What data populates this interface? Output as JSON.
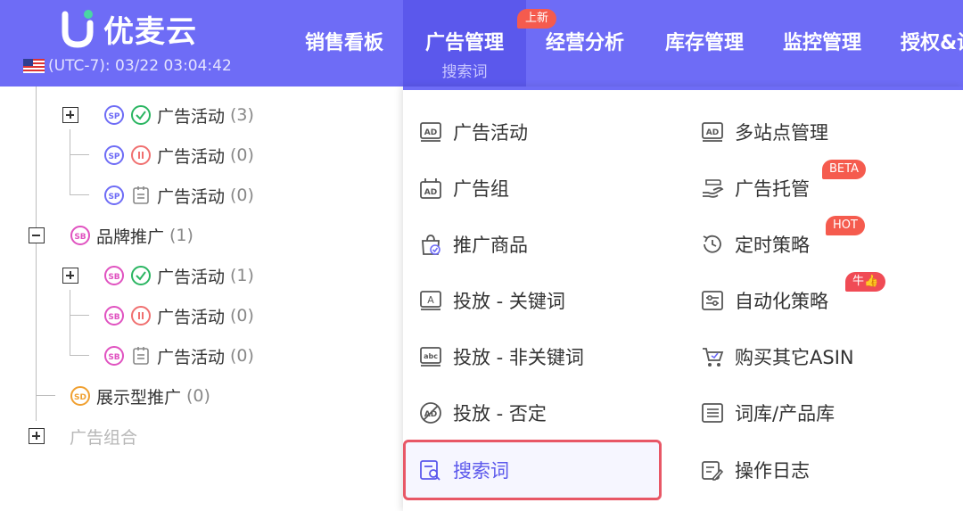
{
  "header": {
    "logo_text": "优麦云",
    "clock": "(UTC-7): 03/22 03:04:42",
    "nav": [
      {
        "label": "销售看板"
      },
      {
        "label": "广告管理",
        "sub": "搜索词",
        "badge": "上新"
      },
      {
        "label": "经营分析"
      },
      {
        "label": "库存管理"
      },
      {
        "label": "监控管理"
      },
      {
        "label": "授权&设"
      }
    ]
  },
  "tree": {
    "sp_rows": [
      {
        "label": "广告活动",
        "count": "(3)"
      },
      {
        "label": "广告活动",
        "count": "(0)"
      },
      {
        "label": "广告活动",
        "count": "(0)"
      }
    ],
    "brand": {
      "label": "品牌推广",
      "count": "(1)"
    },
    "sb_rows": [
      {
        "label": "广告活动",
        "count": "(1)"
      },
      {
        "label": "广告活动",
        "count": "(0)"
      },
      {
        "label": "广告活动",
        "count": "(0)"
      }
    ],
    "display": {
      "label": "展示型推广",
      "count": "(0)"
    },
    "group": {
      "label": "广告组合"
    }
  },
  "menu": {
    "left": [
      {
        "label": "广告活动"
      },
      {
        "label": "广告组"
      },
      {
        "label": "推广商品"
      },
      {
        "label": "投放 - 关键词"
      },
      {
        "label": "投放 - 非关键词"
      },
      {
        "label": "投放 - 否定"
      },
      {
        "label": "搜索词"
      }
    ],
    "right": [
      {
        "label": "多站点管理"
      },
      {
        "label": "广告托管",
        "badge": "BETA"
      },
      {
        "label": "定时策略",
        "badge": "HOT"
      },
      {
        "label": "自动化策略",
        "badge": "牛👍"
      },
      {
        "label": "购买其它ASIN"
      },
      {
        "label": "词库/产品库"
      },
      {
        "label": "操作日志"
      }
    ]
  },
  "colors": {
    "header": "#6e6cf6",
    "active": "#5b58ec",
    "badge": "#f55b4e",
    "highlight": "#e85766"
  }
}
